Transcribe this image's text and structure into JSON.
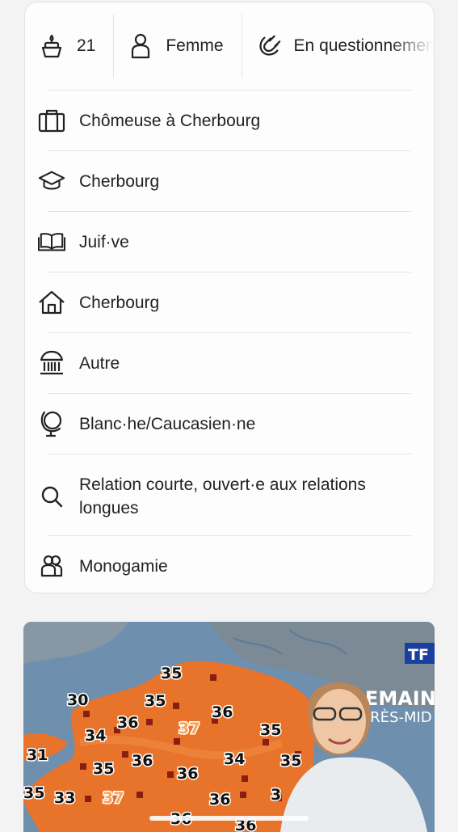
{
  "summary": {
    "age": "21",
    "gender": "Femme",
    "orientation": "En questionnement"
  },
  "details": [
    {
      "icon": "briefcase-icon",
      "label": "Chômeuse à Cherbourg"
    },
    {
      "icon": "graduation-cap-icon",
      "label": "Cherbourg"
    },
    {
      "icon": "book-icon",
      "label": "Juif·ve"
    },
    {
      "icon": "home-icon",
      "label": "Cherbourg"
    },
    {
      "icon": "institution-icon",
      "label": "Autre"
    },
    {
      "icon": "globe-icon",
      "label": "Blanc·he/Caucasien·ne"
    },
    {
      "icon": "search-icon",
      "label": "Relation courte, ouvert·e aux relations longues"
    },
    {
      "icon": "people-icon",
      "label": "Monogamie"
    }
  ],
  "photo": {
    "channel": "TF",
    "banner_title": "DEMAIN",
    "banner_subtitle": "APRÈS-MID",
    "temperatures": [
      "35",
      "30",
      "35",
      "36",
      "37",
      "36",
      "35",
      "34",
      "31",
      "36",
      "35",
      "34",
      "35",
      "36",
      "36",
      "35",
      "33",
      "37",
      "36",
      "36",
      "3"
    ],
    "colors": {
      "sea": "#6f8fae",
      "land_hot": "#e8732a",
      "land_grey": "#7c8a95"
    }
  }
}
